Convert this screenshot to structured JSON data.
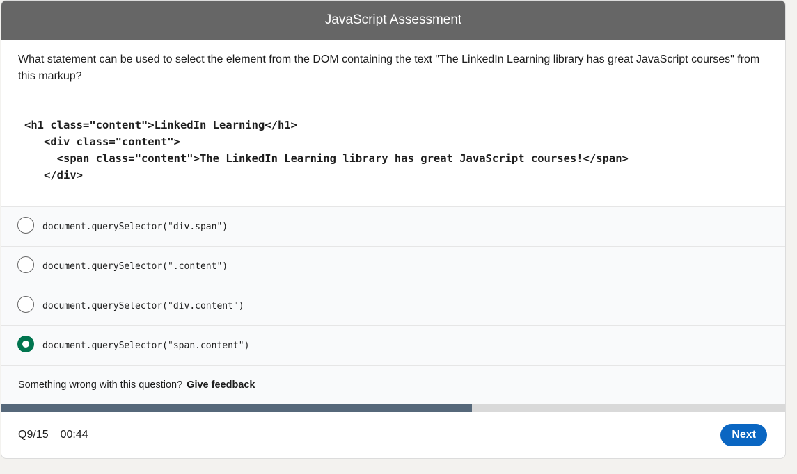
{
  "header": {
    "title": "JavaScript Assessment"
  },
  "question": {
    "text": "What statement can be used to select the element from the DOM containing the text \"The LinkedIn Learning library has great JavaScript courses\" from this markup?"
  },
  "code_lines": [
    "<h1 class=\"content\">LinkedIn Learning</h1>",
    "   <div class=\"content\">",
    "     <span class=\"content\">The LinkedIn Learning library has great JavaScript courses!</span>",
    "   </div>"
  ],
  "options": [
    {
      "label": "document.querySelector(\"div.span\")",
      "selected": false
    },
    {
      "label": "document.querySelector(\".content\")",
      "selected": false
    },
    {
      "label": "document.querySelector(\"div.content\")",
      "selected": false
    },
    {
      "label": "document.querySelector(\"span.content\")",
      "selected": true
    }
  ],
  "feedback": {
    "prompt": "Something wrong with this question?",
    "link": "Give feedback"
  },
  "progress": {
    "fraction": 0.6
  },
  "footer": {
    "question_counter": "Q9/15",
    "timer": "00:44",
    "next_label": "Next"
  },
  "colors": {
    "header_bg": "#666666",
    "selected_radio": "#01754f",
    "progress_fill": "#56687a",
    "next_button": "#0a66c2"
  }
}
